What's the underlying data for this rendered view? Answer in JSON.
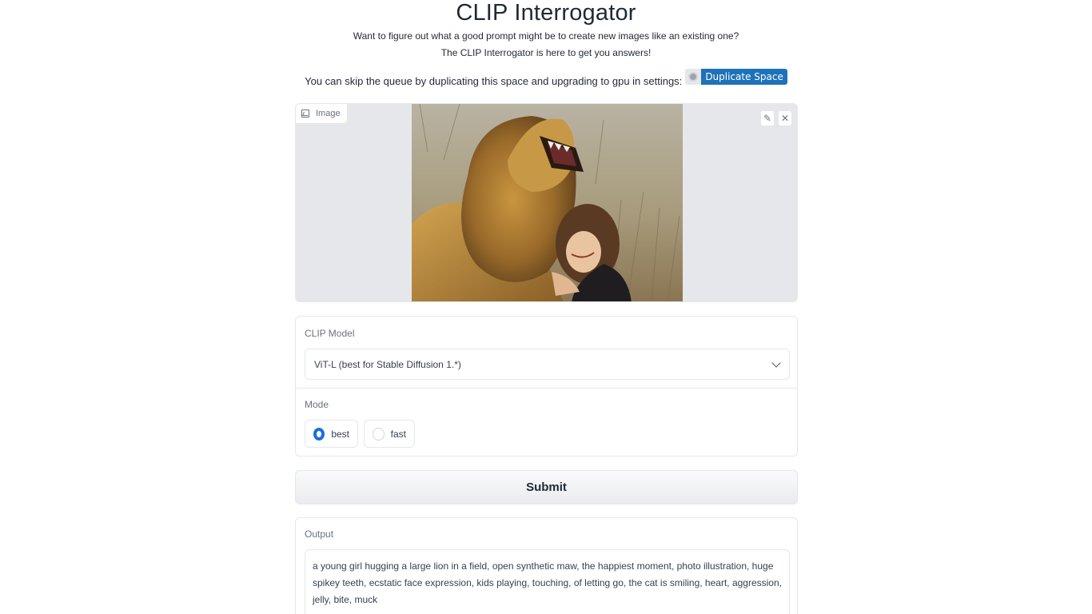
{
  "header": {
    "title": "CLIP Interrogator",
    "description_line1": "Want to figure out what a good prompt might be to create new images like an existing one?",
    "description_line2": "The CLIP Interrogator is here to get you answers!",
    "duplicate_text": "You can skip the queue by duplicating this space and upgrading to gpu in settings:",
    "duplicate_badge": "Duplicate Space"
  },
  "image_input": {
    "label": "Image",
    "edit_icon": "pencil-icon",
    "clear_icon": "close-icon"
  },
  "clip_model": {
    "label": "CLIP Model",
    "selected": "ViT-L (best for Stable Diffusion 1.*)"
  },
  "mode": {
    "label": "Mode",
    "options": [
      {
        "label": "best",
        "selected": true
      },
      {
        "label": "fast",
        "selected": false
      }
    ]
  },
  "submit_label": "Submit",
  "output": {
    "label": "Output",
    "text": "a young girl hugging a large lion in a field, open synthetic maw, the happiest moment, photo illustration, huge spikey teeth, ecstatic face expression, kids playing, touching, of letting go, the cat is smiling, heart, aggression, jelly, bite, muck"
  },
  "colors": {
    "accent": "#1d6fdc",
    "badge_blue": "#1d72b8",
    "panel_bg": "#e5e7eb"
  }
}
